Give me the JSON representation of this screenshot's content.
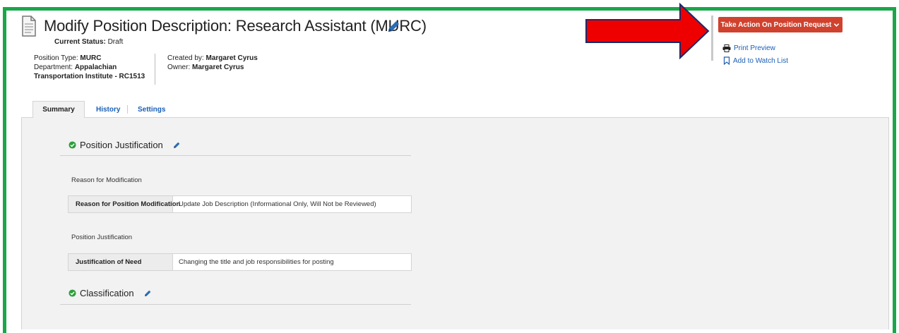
{
  "header": {
    "title": "Modify Position Description: Research Assistant (MURC)",
    "status_label": "Current Status:",
    "status_value": "Draft",
    "position_type_label": "Position Type:",
    "position_type_value": "MURC",
    "department_label": "Department:",
    "department_value_line1": "Appalachian",
    "department_value_line2": "Transportation Institute - RC1513",
    "created_by_label": "Created by:",
    "created_by_value": "Margaret Cyrus",
    "owner_label": "Owner:",
    "owner_value": "Margaret Cyrus"
  },
  "actions": {
    "take_action_label": "Take Action On Position Request",
    "print_preview_label": "Print Preview",
    "watch_list_label": "Add to Watch List"
  },
  "tabs": [
    {
      "label": "Summary",
      "active": true
    },
    {
      "label": "History",
      "active": false
    },
    {
      "label": "Settings",
      "active": false
    }
  ],
  "sections": {
    "justification": {
      "title": "Position Justification",
      "sub1_label": "Reason for Modification",
      "row1_label": "Reason for Position Modification",
      "row1_value": "Update Job Description (Informational Only, Will Not be Reviewed)",
      "sub2_label": "Position Justification",
      "row2_label": "Justification of Need",
      "row2_value": "Changing the title and job responsibilities for posting"
    },
    "classification": {
      "title": "Classification"
    }
  },
  "colors": {
    "frame_border": "#1aa64a",
    "action_button": "#d0422e",
    "link": "#1a5fb4",
    "check_green": "#2e9e3a",
    "arrow_fill": "#ee0000",
    "arrow_outline": "#1a2a6c"
  },
  "icons": {
    "document": "document-icon",
    "edit": "pencil-icon",
    "print": "printer-icon",
    "watch": "bookmark-icon",
    "check": "check-circle-icon",
    "dropdown": "chevron-down-icon",
    "annotation": "red-arrow"
  }
}
